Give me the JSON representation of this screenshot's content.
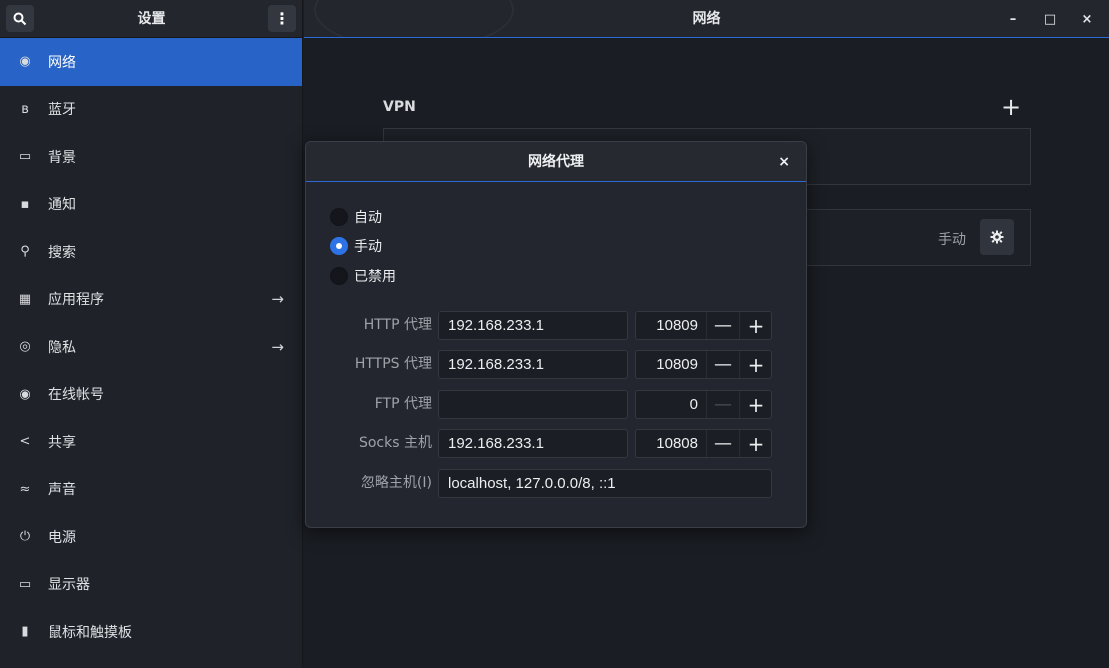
{
  "sidebar": {
    "title": "设置",
    "items": [
      {
        "label": "网络",
        "icon": "network-globe-icon",
        "active": true,
        "arrow": false
      },
      {
        "label": "蓝牙",
        "icon": "bluetooth-icon",
        "active": false,
        "arrow": false
      },
      {
        "label": "背景",
        "icon": "background-monitor-icon",
        "active": false,
        "arrow": false
      },
      {
        "label": "通知",
        "icon": "notification-icon",
        "active": false,
        "arrow": false
      },
      {
        "label": "搜索",
        "icon": "search-icon",
        "active": false,
        "arrow": false
      },
      {
        "label": "应用程序",
        "icon": "apps-grid-icon",
        "active": false,
        "arrow": true
      },
      {
        "label": "隐私",
        "icon": "privacy-icon",
        "active": false,
        "arrow": true
      },
      {
        "label": "在线帐号",
        "icon": "online-accounts-icon",
        "active": false,
        "arrow": false
      },
      {
        "label": "共享",
        "icon": "share-icon",
        "active": false,
        "arrow": false
      },
      {
        "label": "声音",
        "icon": "sound-icon",
        "active": false,
        "arrow": false
      },
      {
        "label": "电源",
        "icon": "power-icon",
        "active": false,
        "arrow": false
      },
      {
        "label": "显示器",
        "icon": "display-icon",
        "active": false,
        "arrow": false
      },
      {
        "label": "鼠标和触摸板",
        "icon": "mouse-icon",
        "active": false,
        "arrow": false
      }
    ]
  },
  "window": {
    "title": "网络",
    "controls": {
      "minimize": "–",
      "maximize": "□",
      "close": "×"
    }
  },
  "main": {
    "vpn_label": "VPN",
    "add_label": "+",
    "proxy_mode": "手动"
  },
  "dialog": {
    "title": "网络代理",
    "close": "×",
    "modes": [
      {
        "label": "自动",
        "selected": false
      },
      {
        "label": "手动",
        "selected": true
      },
      {
        "label": "已禁用",
        "selected": false
      }
    ],
    "fields": [
      {
        "label": "HTTP 代理",
        "host": "192.168.233.1",
        "port": "10809",
        "minus_enabled": true
      },
      {
        "label": "HTTPS 代理",
        "host": "192.168.233.1",
        "port": "10809",
        "minus_enabled": true
      },
      {
        "label": "FTP 代理",
        "host": "",
        "port": "0",
        "minus_enabled": false
      },
      {
        "label": "Socks 主机",
        "host": "192.168.233.1",
        "port": "10808",
        "minus_enabled": true
      }
    ],
    "ignore": {
      "label": "忽略主机(I)",
      "value": "localhost, 127.0.0.0/8, ::1"
    },
    "stepper_minus": "—",
    "stepper_plus": "+"
  },
  "colors": {
    "accent": "#2864c7",
    "background": "#1a1d23"
  }
}
